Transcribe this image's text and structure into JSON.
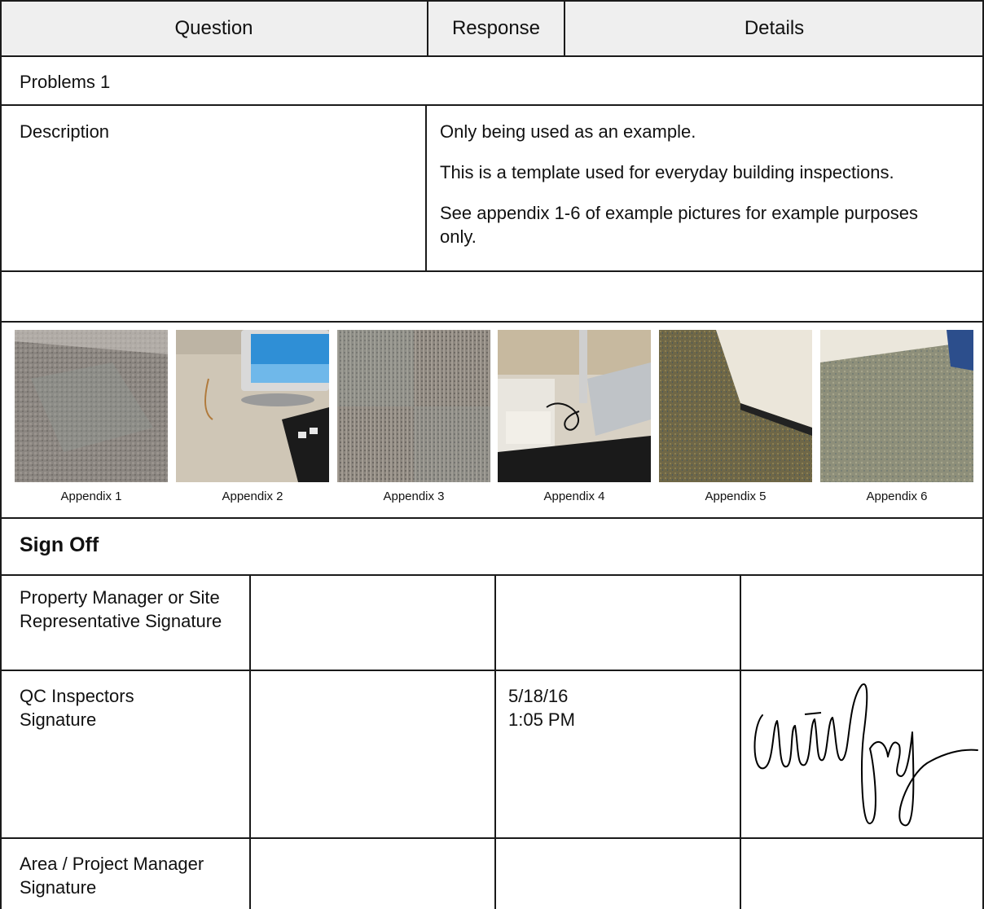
{
  "header": {
    "question": "Question",
    "response": "Response",
    "details": "Details"
  },
  "problems_title": "Problems 1",
  "description": {
    "label": "Description",
    "paragraphs": [
      "Only being used as an example.",
      "This is a template used for everyday building inspections.",
      "See appendix 1-6 of example pictures for example purposes only."
    ]
  },
  "appendix": {
    "captions": [
      "Appendix 1",
      "Appendix 2",
      "Appendix 3",
      "Appendix 4",
      "Appendix 5",
      "Appendix 6"
    ]
  },
  "sign_off": {
    "title": "Sign Off",
    "rows": [
      {
        "label": "Property Manager or Site Representative Signature",
        "date": "",
        "time": ""
      },
      {
        "label": "QC Inspectors Signature",
        "date": "5/18/16",
        "time": "1:05 PM"
      },
      {
        "label": "Area / Project Manager Signature",
        "date": "",
        "time": ""
      }
    ]
  }
}
